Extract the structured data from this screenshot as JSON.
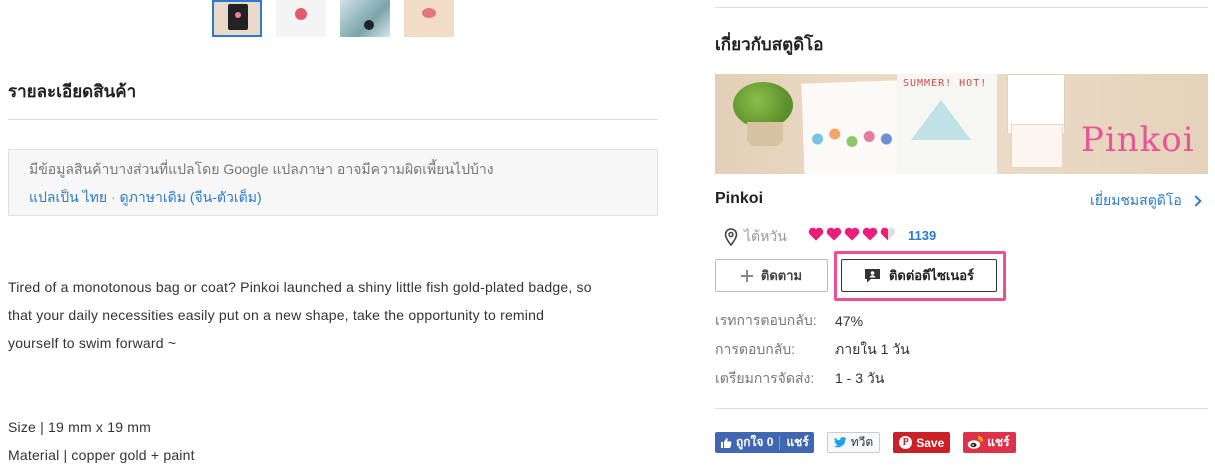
{
  "gallery": {
    "thumbnails": [
      "thumb-badge-card",
      "thumb-badge-white",
      "thumb-badge-teal",
      "thumb-badge-peach"
    ],
    "active_index": 0
  },
  "details": {
    "title": "รายละเอียดสินค้า",
    "translation": {
      "note": "มีข้อมูลสินค้าบางส่วนที่แปลโดย Google แปลภาษา อาจมีความผิดเพี้ยนไปบ้าง",
      "translate_link": "แปลเป็น ไทย",
      "separator": "·",
      "original_link": "ดูภาษาเดิม (จีน-ตัวเต็ม)"
    },
    "description_lines": [
      "Tired of a monotonous bag or coat? Pinkoi launched a shiny little fish gold-plated badge, so",
      "that your daily necessities easily put on a new shape, take the opportunity to remind",
      "yourself to swim forward ~"
    ],
    "specs": [
      "Size | 19 mm x 19 mm",
      "Material | copper gold + paint"
    ]
  },
  "studio": {
    "section_title": "เกี่ยวกับสตูดิโอ",
    "banner_text": "SUMMER! HOT!",
    "banner_logo": "Pinkoi",
    "name": "Pinkoi",
    "visit_label": "เยี่ยมชมสตูดิโอ",
    "location": "ไต้หวัน",
    "rating_hearts": 4.5,
    "rating_count": "1139",
    "follow_label": "ติดตาม",
    "contact_label": "ติดต่อดีไซเนอร์",
    "stats": [
      {
        "label": "เรทการตอบกลับ:",
        "value": "47%"
      },
      {
        "label": "การตอบกลับ:",
        "value": "ภายใน 1 วัน"
      },
      {
        "label": "เตรียมการจัดส่ง:",
        "value": "1 - 3 วัน"
      }
    ],
    "highlight_color": "#ee4e94"
  },
  "share": {
    "facebook_like": "ถูกใจ 0",
    "facebook_share": "แชร์",
    "twitter": "ทวีต",
    "pinterest": "Save",
    "weibo": "แชร์"
  },
  "colors": {
    "link": "#2a7ad0",
    "heart": "#ee1c7a",
    "facebook": "#4267b2",
    "pinterest": "#cb2027",
    "weibo": "#e0314a"
  }
}
